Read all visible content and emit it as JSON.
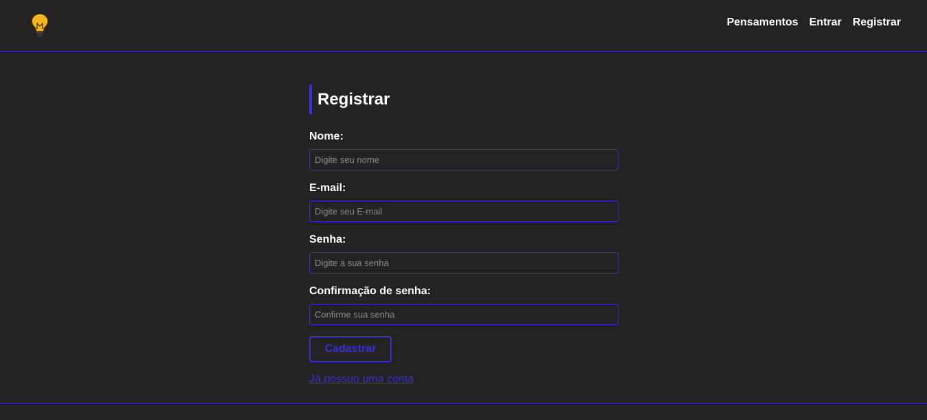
{
  "nav": {
    "logo_icon": "lightbulb-icon",
    "links": [
      "Pensamentos",
      "Entrar",
      "Registrar"
    ]
  },
  "form": {
    "title": "Registrar",
    "fields": [
      {
        "label": "Nome:",
        "placeholder": "Digite seu nome",
        "value": ""
      },
      {
        "label": "E-mail:",
        "placeholder": "Digite seu E-mail",
        "value": ""
      },
      {
        "label": "Senha:",
        "placeholder": "Digite a sua senha",
        "value": ""
      },
      {
        "label": "Confirmação de senha:",
        "placeholder": "Confirme sua senha",
        "value": ""
      }
    ],
    "submit_label": "Cadastrar",
    "login_link": "Já possuo uma conta"
  },
  "colors": {
    "background": "#232323",
    "accent": "#3a2fd6",
    "logo_yellow": "#f5b51e"
  }
}
